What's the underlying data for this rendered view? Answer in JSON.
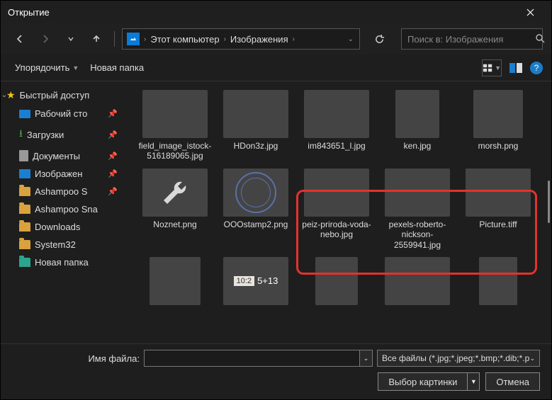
{
  "window": {
    "title": "Открытие"
  },
  "nav": {
    "path": [
      "Этот компьютер",
      "Изображения"
    ],
    "search_placeholder": "Поиск в: Изображения"
  },
  "toolbar": {
    "organize": "Упорядочить",
    "new_folder": "Новая папка"
  },
  "sidebar": {
    "quick": "Быстрый доступ",
    "items": [
      {
        "label": "Рабочий сто",
        "pin": true,
        "icon": "desk"
      },
      {
        "label": "Загрузки",
        "pin": true,
        "icon": "down"
      },
      {
        "label": "Документы",
        "pin": true,
        "icon": "doc"
      },
      {
        "label": "Изображен",
        "pin": true,
        "icon": "pic"
      },
      {
        "label": "Ashampoo S",
        "pin": true,
        "icon": "folder"
      },
      {
        "label": "Ashampoo Sna",
        "pin": false,
        "icon": "folder"
      },
      {
        "label": "Downloads",
        "pin": false,
        "icon": "folder"
      },
      {
        "label": "System32",
        "pin": false,
        "icon": "folder"
      },
      {
        "label": "Новая папка",
        "pin": false,
        "icon": "folder-teal"
      }
    ]
  },
  "files": [
    {
      "name": "field_image_istock-516189065.jpg",
      "thumb": "g-space"
    },
    {
      "name": "HDon3z.jpg",
      "thumb": "g-horse"
    },
    {
      "name": "im843651_l.jpg",
      "thumb": "g-babe"
    },
    {
      "name": "ken.jpg",
      "thumb": "g-ken"
    },
    {
      "name": "morsh.png",
      "thumb": "g-face2"
    },
    {
      "name": "Noznet.png",
      "thumb": "g-tool"
    },
    {
      "name": "OOOstamp2.png",
      "thumb": "g-stamp"
    },
    {
      "name": "peiz-priroda-voda-nebo.jpg",
      "thumb": "g-lake"
    },
    {
      "name": "pexels-roberto-nickson-2559941.jpg",
      "thumb": "g-mnt"
    },
    {
      "name": "Picture.tiff",
      "thumb": "g-mnt2"
    },
    {
      "name": "",
      "thumb": "g-cd"
    },
    {
      "name": "",
      "thumb": "g-pink"
    },
    {
      "name": "",
      "thumb": "g-face3"
    },
    {
      "name": "",
      "thumb": "g-grad"
    },
    {
      "name": "",
      "thumb": "g-teal"
    }
  ],
  "pink_text": {
    "a": "10:2",
    "b": "5+13"
  },
  "footer": {
    "filename_label": "Имя файла:",
    "filename_value": "",
    "filter": "Все файлы (*.jpg;*.jpeg;*.bmp;*.dib;*.p",
    "open": "Выбор картинки",
    "cancel": "Отмена"
  }
}
